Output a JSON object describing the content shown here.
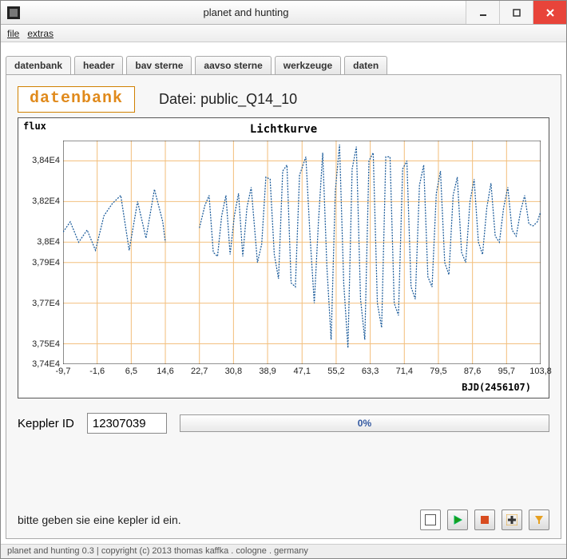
{
  "window": {
    "title": "planet and hunting"
  },
  "menu": {
    "file": "file",
    "extras": "extras"
  },
  "tabs": {
    "items": [
      "datenbank",
      "header",
      "bav sterne",
      "aavso sterne",
      "werkzeuge",
      "daten"
    ],
    "active": 0
  },
  "dbheader": {
    "badge": "datenbank",
    "file_prefix": "Datei: ",
    "file_name": "public_Q14_10"
  },
  "form": {
    "keppler_label": "Keppler ID",
    "keppler_value": "12307039",
    "progress_text": "0%"
  },
  "status": {
    "text": "bitte geben sie eine kepler id ein."
  },
  "footer": {
    "text": "planet and hunting 0.3 | copyright (c) 2013 thomas kaffka . cologne . germany"
  },
  "chart_data": {
    "type": "line",
    "title": "Lichtkurve",
    "ylabel": "flux",
    "xlabel": "BJD(2456107)",
    "xlim": [
      -9.7,
      103.8
    ],
    "ylim": [
      37400,
      38500
    ],
    "xticks": [
      -9.7,
      -1.6,
      6.5,
      14.6,
      22.7,
      30.8,
      38.9,
      47.1,
      55.2,
      63.3,
      71.4,
      79.5,
      87.6,
      95.7,
      103.8
    ],
    "yticks_values": [
      37400,
      37500,
      37700,
      37900,
      38000,
      38200,
      38400
    ],
    "yticks_labels": [
      "3,74E4",
      "3,75E4",
      "3,77E4",
      "3,79E4",
      "3,8E4",
      "3,82E4",
      "3,84E4"
    ],
    "series": [
      {
        "name": "flux",
        "x": [
          -9.7,
          -8,
          -6,
          -4,
          -2,
          0,
          2,
          4,
          6,
          8,
          10,
          12,
          14,
          14.6,
          22.7,
          24,
          25,
          26,
          27,
          28,
          29,
          30,
          31,
          32,
          33,
          34,
          35,
          36.5,
          37.5,
          38.5,
          39.5,
          40.5,
          41.5,
          42.5,
          43.5,
          44.5,
          45.5,
          46.5,
          48,
          49,
          50,
          51,
          52,
          53,
          54,
          55,
          56,
          57,
          58,
          59,
          60,
          61,
          62,
          63,
          64,
          65,
          66,
          67,
          68,
          69,
          70,
          71,
          72,
          73,
          74,
          75,
          76,
          77,
          78,
          79,
          80,
          81,
          82,
          83,
          84,
          85,
          86,
          87,
          88,
          89,
          90,
          91,
          92,
          93,
          94,
          95,
          96,
          97,
          98,
          99,
          100,
          101,
          102,
          103,
          103.8
        ],
        "y": [
          38050,
          38100,
          38000,
          38060,
          37960,
          38130,
          38190,
          38230,
          37960,
          38200,
          38020,
          38260,
          38100,
          38000,
          38070,
          38180,
          38230,
          37950,
          37930,
          38130,
          38230,
          37940,
          38130,
          38240,
          37930,
          38170,
          38270,
          37900,
          37990,
          38320,
          38310,
          37940,
          37820,
          38350,
          38380,
          37800,
          37780,
          38330,
          38420,
          38030,
          37700,
          38100,
          38440,
          37880,
          37520,
          38250,
          38480,
          37800,
          37480,
          38360,
          38470,
          37720,
          37520,
          38400,
          38440,
          37700,
          37580,
          38420,
          38420,
          37700,
          37640,
          38360,
          38400,
          37780,
          37720,
          38280,
          38380,
          37830,
          37780,
          38240,
          38350,
          37900,
          37840,
          38230,
          38320,
          37950,
          37900,
          38200,
          38310,
          38000,
          37940,
          38170,
          38290,
          38030,
          38000,
          38170,
          38270,
          38060,
          38030,
          38150,
          38230,
          38090,
          38080,
          38100,
          38150
        ]
      }
    ]
  }
}
